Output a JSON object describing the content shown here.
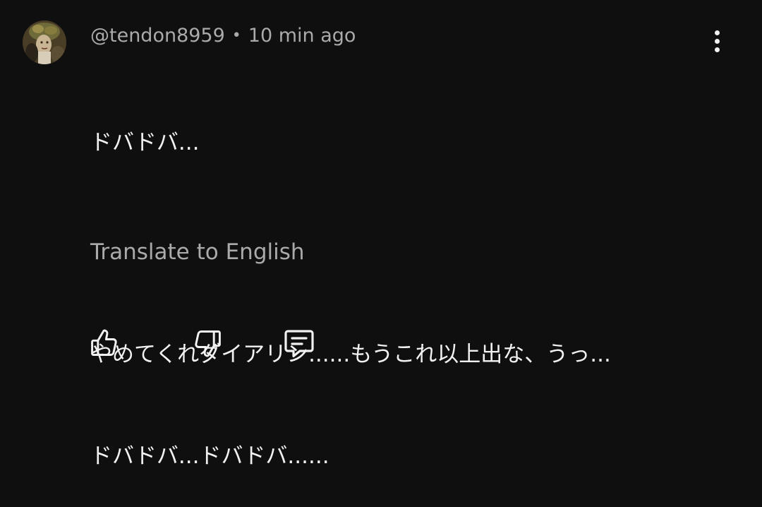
{
  "comment": {
    "author": "@tendon8959",
    "separator": "•",
    "time": "10 min ago",
    "lines": [
      "ドバドバ...",
      "やめてくれダイアリン......もうこれ以上出な、うっ...",
      "ドバドバ...ドバドバ......"
    ],
    "translate_label": "Translate to English"
  },
  "icons": {
    "avatar": "avatar-image",
    "more": "more-vertical-icon",
    "like": "thumbs-up-icon",
    "dislike": "thumbs-down-icon",
    "reply": "reply-comment-icon"
  },
  "colors": {
    "background": "#0f0f0f",
    "primary_text": "#f1f1f1",
    "secondary_text": "#aaaaaa"
  }
}
